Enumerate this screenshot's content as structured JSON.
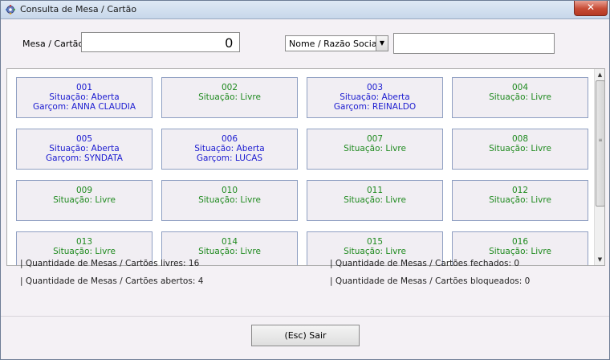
{
  "window": {
    "title": "Consulta de Mesa / Cartão",
    "close_label": "✕"
  },
  "search": {
    "mesa_label": "Mesa / Cartão:",
    "mesa_value": "0",
    "filter_selected": "Nome / Razão Social",
    "filter_arrow": "▼",
    "text_value": ""
  },
  "tables": [
    {
      "number": "001",
      "status": "Situação: Aberta",
      "waiter": "Garçom: ANNA CLAUDIA",
      "state": "aberta"
    },
    {
      "number": "002",
      "status": "Situação: Livre",
      "waiter": "",
      "state": "livre"
    },
    {
      "number": "003",
      "status": "Situação: Aberta",
      "waiter": "Garçom: REINALDO",
      "state": "aberta"
    },
    {
      "number": "004",
      "status": "Situação: Livre",
      "waiter": "",
      "state": "livre"
    },
    {
      "number": "005",
      "status": "Situação: Aberta",
      "waiter": "Garçom: SYNDATA",
      "state": "aberta"
    },
    {
      "number": "006",
      "status": "Situação: Aberta",
      "waiter": "Garçom: LUCAS",
      "state": "aberta"
    },
    {
      "number": "007",
      "status": "Situação: Livre",
      "waiter": "",
      "state": "livre"
    },
    {
      "number": "008",
      "status": "Situação: Livre",
      "waiter": "",
      "state": "livre"
    },
    {
      "number": "009",
      "status": "Situação: Livre",
      "waiter": "",
      "state": "livre"
    },
    {
      "number": "010",
      "status": "Situação: Livre",
      "waiter": "",
      "state": "livre"
    },
    {
      "number": "011",
      "status": "Situação: Livre",
      "waiter": "",
      "state": "livre"
    },
    {
      "number": "012",
      "status": "Situação: Livre",
      "waiter": "",
      "state": "livre"
    },
    {
      "number": "013",
      "status": "Situação: Livre",
      "waiter": "",
      "state": "livre"
    },
    {
      "number": "014",
      "status": "Situação: Livre",
      "waiter": "",
      "state": "livre"
    },
    {
      "number": "015",
      "status": "Situação: Livre",
      "waiter": "",
      "state": "livre"
    },
    {
      "number": "016",
      "status": "Situação: Livre",
      "waiter": "",
      "state": "livre"
    }
  ],
  "stats": {
    "livres": "| Quantidade de Mesas / Cartões livres: 16",
    "abertos": "| Quantidade de Mesas / Cartões abertos: 4",
    "fechados": "| Quantidade de Mesas / Cartões fechados: 0",
    "bloqueados": "| Quantidade de Mesas / Cartões bloqueados: 0"
  },
  "buttons": {
    "sair": "(Esc) Sair"
  },
  "colors": {
    "aberta": "#1a1ad0",
    "livre": "#1f8a1f"
  },
  "scrollbar": {
    "up": "▲",
    "down": "▼",
    "grip": "≡"
  }
}
